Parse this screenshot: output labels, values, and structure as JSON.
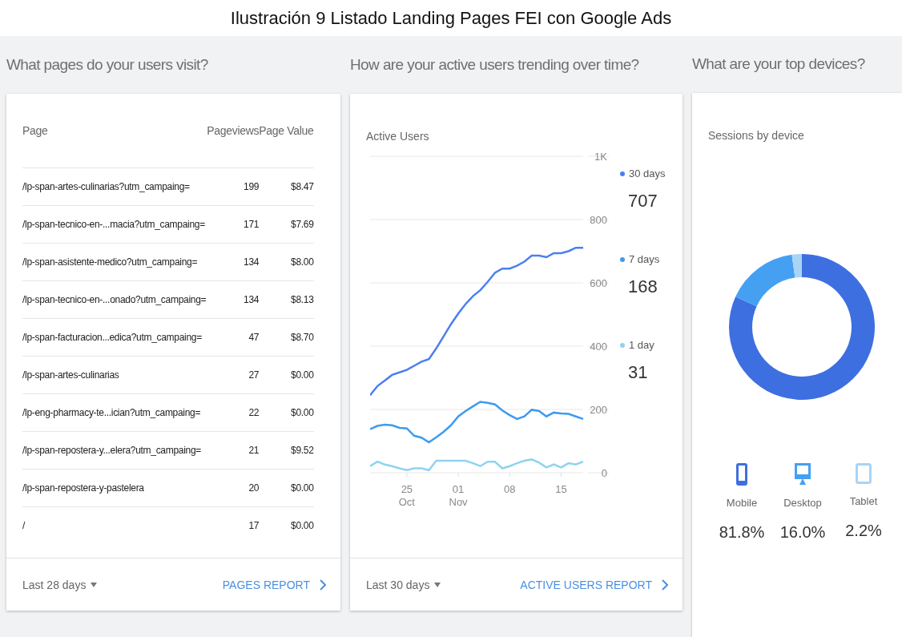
{
  "caption": "Ilustración 9 Listado Landing Pages FEI con Google Ads",
  "pages": {
    "heading": "What pages do your users visit?",
    "columns": [
      "Page",
      "Pageviews",
      "Page Value"
    ],
    "rows": [
      {
        "page": "/lp-span-artes-culinarias?utm_campaing=",
        "pageviews": "199",
        "page_value": "$8.47"
      },
      {
        "page": "/lp-span-tecnico-en-...macia?utm_campaing=",
        "pageviews": "171",
        "page_value": "$7.69"
      },
      {
        "page": "/lp-span-asistente-medico?utm_campaing=",
        "pageviews": "134",
        "page_value": "$8.00"
      },
      {
        "page": "/lp-span-tecnico-en-...onado?utm_campaing=",
        "pageviews": "134",
        "page_value": "$8.13"
      },
      {
        "page": "/lp-span-facturacion...edica?utm_campaing=",
        "pageviews": "47",
        "page_value": "$8.70"
      },
      {
        "page": "/lp-span-artes-culinarias",
        "pageviews": "27",
        "page_value": "$0.00"
      },
      {
        "page": "/lp-eng-pharmacy-te...ician?utm_campaing=",
        "pageviews": "22",
        "page_value": "$0.00"
      },
      {
        "page": "/lp-span-repostera-y...elera?utm_campaing=",
        "pageviews": "21",
        "page_value": "$9.52"
      },
      {
        "page": "/lp-span-repostera-y-pastelera",
        "pageviews": "20",
        "page_value": "$0.00"
      },
      {
        "page": "/",
        "pageviews": "17",
        "page_value": "$0.00"
      }
    ],
    "range": "Last 28 days",
    "report_link": "PAGES REPORT"
  },
  "active_users": {
    "heading": "How are your active users trending over time?",
    "title": "Active Users",
    "chart_data": {
      "type": "line",
      "categories": [
        null,
        null,
        null,
        null,
        null,
        "25 Oct",
        null,
        null,
        null,
        null,
        null,
        null,
        "01 Nov",
        null,
        null,
        null,
        null,
        null,
        null,
        "08",
        null,
        null,
        null,
        null,
        null,
        null,
        "15",
        null,
        null,
        null
      ],
      "ylim": [
        0,
        1000
      ],
      "grid": true,
      "yticks": [
        0,
        200,
        400,
        600,
        800,
        {
          "value": 1000,
          "label": "1K"
        }
      ],
      "series": [
        {
          "name": "30 days",
          "color": "#4a7ff0",
          "values": [
            245,
            274,
            291,
            309,
            317,
            325,
            338,
            351,
            359,
            393,
            431,
            469,
            503,
            533,
            558,
            577,
            603,
            632,
            645,
            645,
            654,
            667,
            686,
            686,
            681,
            694,
            694,
            700,
            711,
            711
          ]
        },
        {
          "name": "7 days",
          "color": "#3d9bf0",
          "values": [
            138,
            148,
            152,
            150,
            142,
            140,
            117,
            111,
            96,
            112,
            129,
            150,
            178,
            195,
            210,
            224,
            221,
            216,
            197,
            182,
            170,
            178,
            199,
            195,
            178,
            190,
            187,
            186,
            178,
            170
          ]
        },
        {
          "name": "1 day",
          "color": "#8fd3f0",
          "values": [
            21,
            35,
            26,
            21,
            14,
            8,
            14,
            14,
            8,
            38,
            38,
            38,
            38,
            38,
            30,
            21,
            35,
            35,
            14,
            21,
            30,
            38,
            42,
            32,
            17,
            26,
            17,
            30,
            26,
            35
          ]
        }
      ]
    },
    "legend_values": [
      "707",
      "168",
      "31"
    ],
    "range": "Last 30 days",
    "report_link": "ACTIVE USERS REPORT"
  },
  "devices": {
    "heading": "What are your top devices?",
    "title": "Sessions by device",
    "chart_data": {
      "type": "donut",
      "categories": [
        "Mobile",
        "Desktop",
        "Tablet"
      ],
      "values": [
        81.8,
        16.0,
        2.2
      ]
    },
    "items": [
      {
        "kind": "mobile",
        "share": "81.8%",
        "color": "#3d6fe0"
      },
      {
        "kind": "desktop",
        "share": "16.0%",
        "color": "#45a0f2"
      },
      {
        "kind": "tablet",
        "share": "2.2%",
        "color": "#a8d4f6"
      }
    ]
  }
}
